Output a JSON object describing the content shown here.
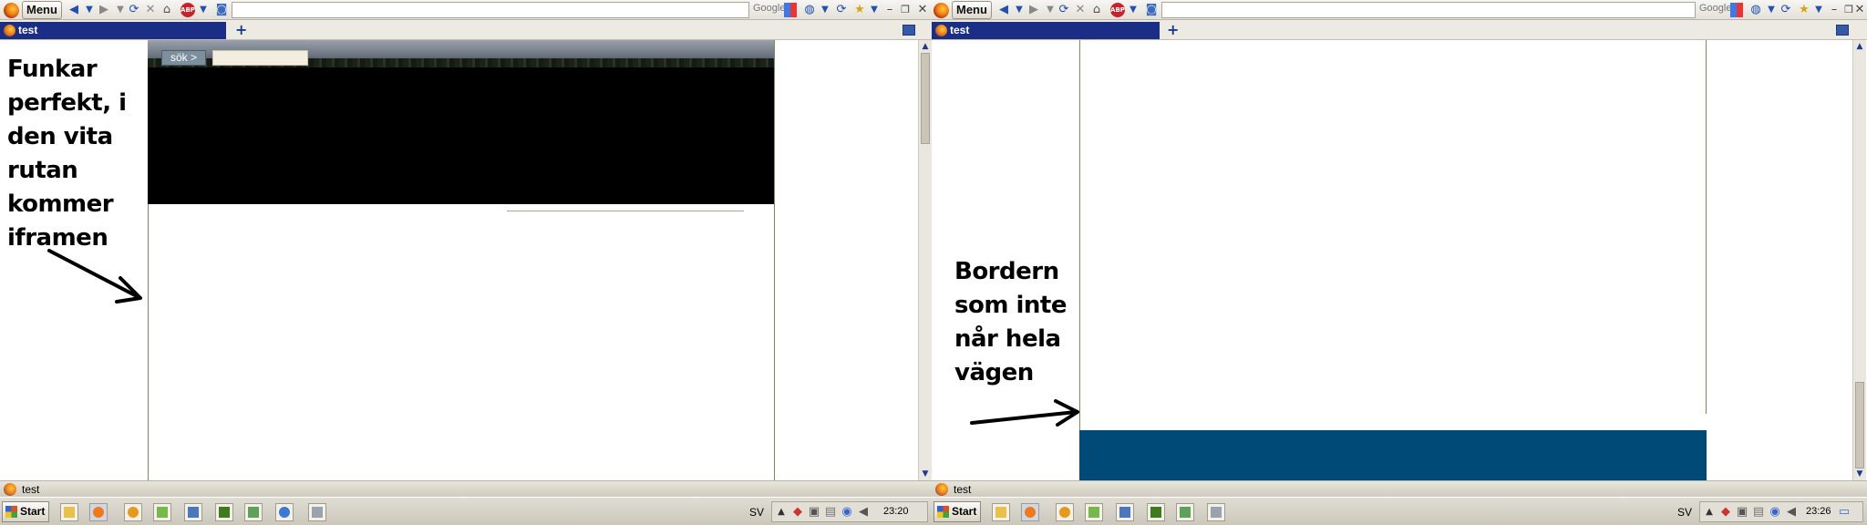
{
  "browser": {
    "menu_label": "Menu",
    "tab_title": "test",
    "new_tab": "+",
    "search_engine": "Google",
    "abp_label": "ABP",
    "status_text": "test"
  },
  "taskbar": {
    "start_label": "Start",
    "left": {
      "lang": "SV",
      "time": "23:20"
    },
    "right": {
      "lang": "SV",
      "time": "23:26"
    }
  },
  "left_page": {
    "search_button": "sök >",
    "annotation": "Funkar\nperfekt, i\nden vita\nrutan\nkommer\niframen"
  },
  "right_page": {
    "annotation": "Bordern\nsom inte\nnår hela\nvägen"
  },
  "colors": {
    "tab_active": "#1b2e85",
    "footer_blue": "#004a78",
    "border_line": "#7b8a5a"
  },
  "icons": [
    "firefox-icon",
    "back-icon",
    "forward-icon",
    "reload-icon",
    "stop-icon",
    "home-icon",
    "abp-icon",
    "page-icon",
    "bookmark-star-icon",
    "windows-flag-icon",
    "arrow-icon"
  ]
}
